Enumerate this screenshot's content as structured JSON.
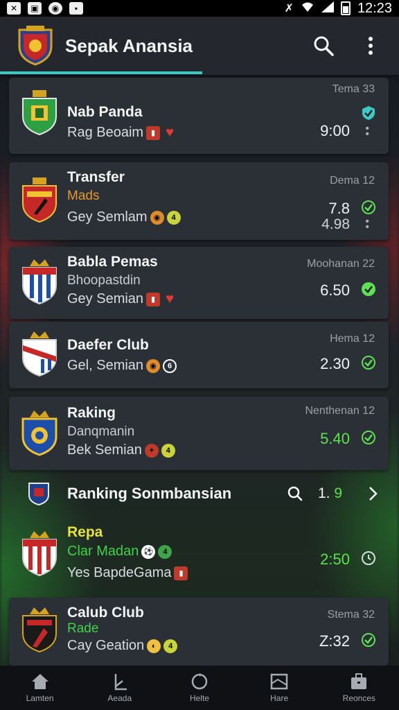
{
  "status_bar": {
    "time": "12:23"
  },
  "app": {
    "title": "Sepak Anansia",
    "colors": {
      "accent": "#3cc8c4",
      "card": "#2b2f36",
      "positive": "#5fe053"
    }
  },
  "matches": [
    {
      "team": "Nab Panda",
      "sub": "",
      "line3": "Rag Beoaim",
      "tag": "Tema 33",
      "odds": "9:00",
      "crest": "green"
    },
    {
      "team": "Transfer",
      "sub": "Mads",
      "sub_color": "orange",
      "line3": "Gey Semlam",
      "tag": "Dema 12",
      "odds": "7.8",
      "odds_b": "4.98",
      "crest": "red-yellow"
    },
    {
      "team": "Babla Pemas",
      "sub": "Bhoopastdin",
      "sub_color": "grey",
      "line3": "Gey Semian",
      "tag": "Moohanan 22",
      "odds": "6.50",
      "crest": "red-blue"
    },
    {
      "team": "Daefer Club",
      "sub": "",
      "line3": "Gel, Semian",
      "tag": "Hema 12",
      "odds": "2.30",
      "crest": "red-white"
    },
    {
      "team": "Raking",
      "sub": "Danqmanin",
      "sub_color": "grey",
      "line3": "Bek Semian",
      "tag": "Nenthenan 12",
      "odds": "5.40",
      "odds_color": "green",
      "crest": "blue-yellow"
    }
  ],
  "ranking": {
    "title": "Ranking Sonmbansian",
    "count_prefix": "1.",
    "count_value": "9"
  },
  "ranking_items": [
    {
      "team": "Repa",
      "team_color": "yellow",
      "sub": "Clar Madan",
      "sub_color": "green",
      "line3": "Yes BapdeGama",
      "odds": "2:50",
      "odds_color": "green",
      "crest": "red-white"
    },
    {
      "team": "Calub Club",
      "sub": "Rade",
      "sub_color": "green",
      "line3": "Cay Geation",
      "tag": "Stema 32",
      "odds": "Z:32",
      "crest": "black-red"
    }
  ],
  "bottom_nav": [
    {
      "label": "Lamten",
      "icon": "home-icon"
    },
    {
      "label": "Aeada",
      "icon": "stats-icon"
    },
    {
      "label": "Helte",
      "icon": "refresh-icon"
    },
    {
      "label": "Hare",
      "icon": "board-icon"
    },
    {
      "label": "Reonces",
      "icon": "briefcase-icon"
    }
  ]
}
